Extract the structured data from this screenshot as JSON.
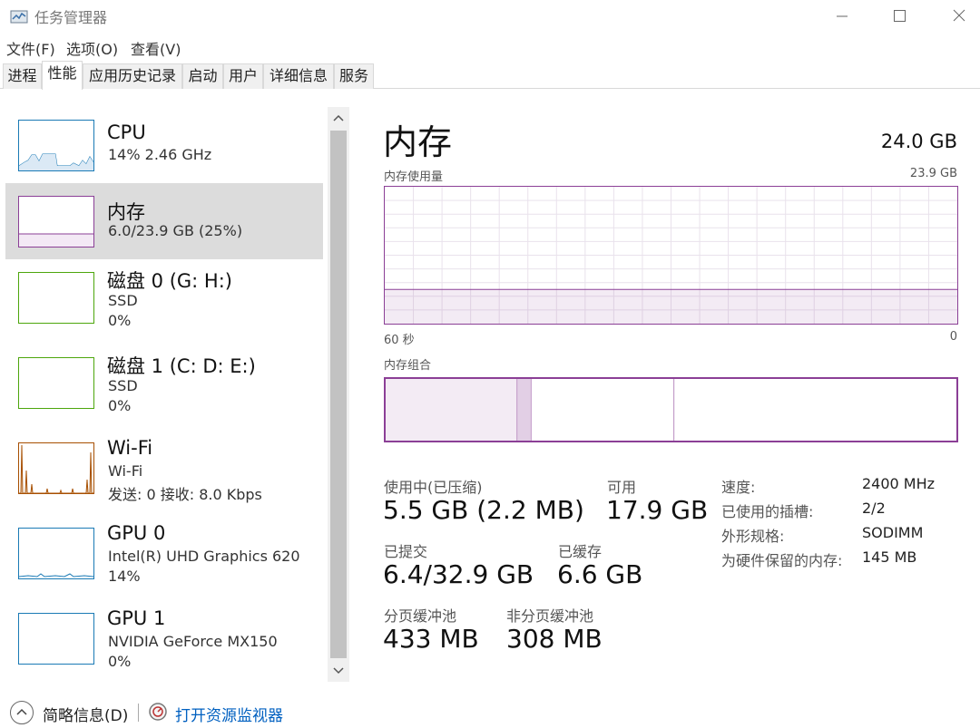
{
  "window": {
    "title": "任务管理器"
  },
  "menu": [
    "文件(F)",
    "选项(O)",
    "查看(V)"
  ],
  "tabs": [
    "进程",
    "性能",
    "应用历史记录",
    "启动",
    "用户",
    "详细信息",
    "服务"
  ],
  "active_tab": "性能",
  "resources": [
    {
      "name": "CPU",
      "line1": "14%  2.46 GHz",
      "line2": "",
      "color": "#1a7ab5"
    },
    {
      "name": "内存",
      "line1": "6.0/23.9 GB (25%)",
      "line2": "",
      "color": "#8b3f96",
      "selected": true
    },
    {
      "name": "磁盘 0 (G: H:)",
      "line1": "SSD",
      "line2": "0%",
      "color": "#4da60c"
    },
    {
      "name": "磁盘 1 (C: D: E:)",
      "line1": "SSD",
      "line2": "0%",
      "color": "#4da60c"
    },
    {
      "name": "Wi-Fi",
      "line1": "Wi-Fi",
      "line2": "发送: 0  接收: 8.0 Kbps",
      "color": "#a74f01"
    },
    {
      "name": "GPU 0",
      "line1": "Intel(R) UHD Graphics 620",
      "line2": "14%",
      "color": "#1a7ab5"
    },
    {
      "name": "GPU 1",
      "line1": "NVIDIA GeForce MX150",
      "line2": "0%",
      "color": "#1a7ab5"
    }
  ],
  "detail": {
    "title": "内存",
    "total": "24.0 GB",
    "usage_label": "内存使用量",
    "usage_max": "23.9 GB",
    "time_left": "60 秒",
    "time_right": "0",
    "usage_fraction": 0.25,
    "composition_label": "内存组合",
    "composition": {
      "in_use_fraction": 0.23,
      "modified_fraction": 0.025,
      "standby_fraction": 0.25
    },
    "stats": {
      "in_use_label": "使用中(已压缩)",
      "in_use_value": "5.5 GB (2.2 MB)",
      "available_label": "可用",
      "available_value": "17.9 GB",
      "committed_label": "已提交",
      "committed_value": "6.4/32.9 GB",
      "cached_label": "已缓存",
      "cached_value": "6.6 GB",
      "paged_label": "分页缓冲池",
      "paged_value": "433 MB",
      "nonpaged_label": "非分页缓冲池",
      "nonpaged_value": "308 MB"
    },
    "properties": [
      {
        "key": "速度:",
        "value": "2400 MHz"
      },
      {
        "key": "已使用的插槽:",
        "value": "2/2"
      },
      {
        "key": "外形规格:",
        "value": "SODIMM"
      },
      {
        "key": "为硬件保留的内存:",
        "value": "145 MB"
      }
    ]
  },
  "footer": {
    "brief": "简略信息(D)",
    "link": "打开资源监视器"
  },
  "colors": {
    "memory_accent": "#8b3f96",
    "link": "#0060c0"
  }
}
